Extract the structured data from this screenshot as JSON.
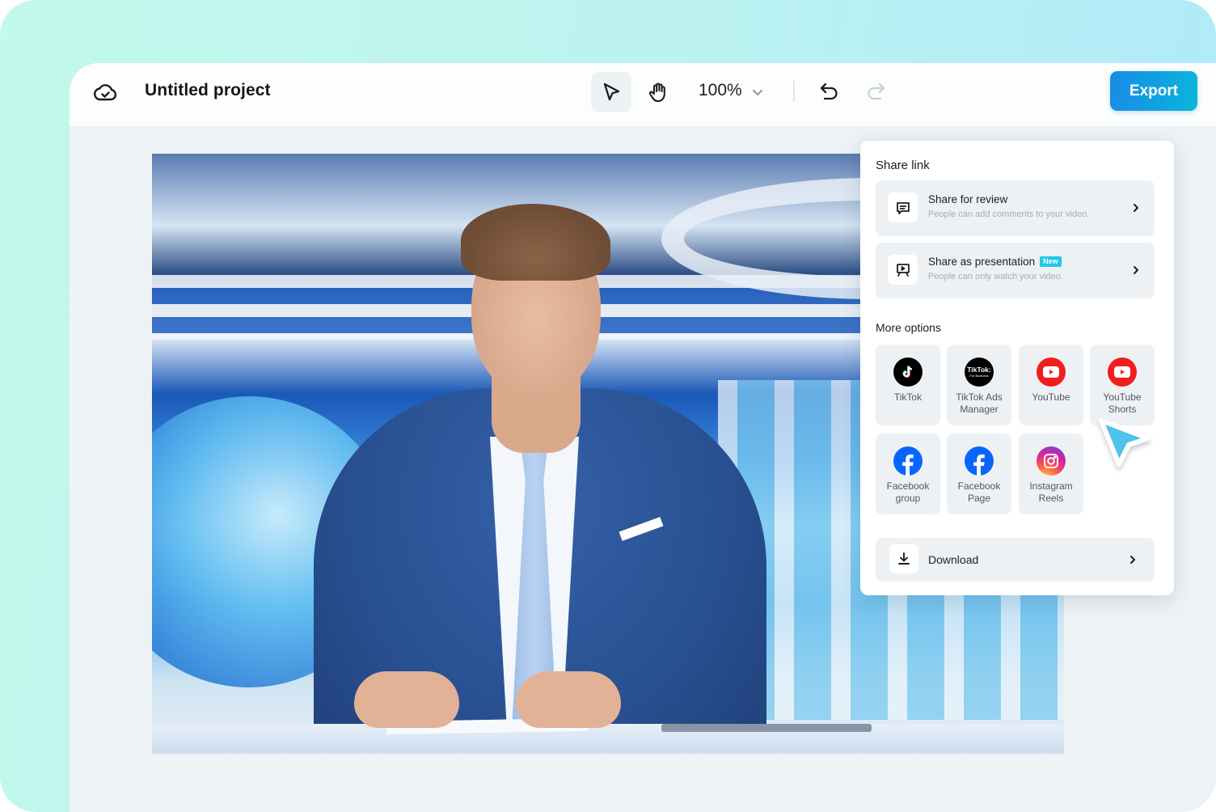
{
  "header": {
    "project_title": "Untitled project",
    "zoom_level": "100%",
    "export_label": "Export",
    "icons": {
      "cloud": "cloud-check-icon",
      "select": "pointer-arrow-icon",
      "hand": "hand-pan-icon",
      "zoom_dropdown": "chevron-down-icon",
      "undo": "undo-icon",
      "redo": "redo-icon"
    }
  },
  "canvas": {
    "media_description": "News anchor in blue suit at studio desk"
  },
  "share_panel": {
    "share_link_heading": "Share link",
    "share_options": [
      {
        "title": "Share for review",
        "subtitle": "People can add comments to your video.",
        "icon": "comment-icon",
        "badge": ""
      },
      {
        "title": "Share as presentation",
        "subtitle": "People can only watch your video.",
        "icon": "presentation-icon",
        "badge": "New"
      }
    ],
    "more_options_heading": "More options",
    "platforms": [
      {
        "label": "TikTok",
        "icon": "tiktok-icon",
        "color": "#000000"
      },
      {
        "label": "TikTok Ads Manager",
        "icon": "tiktok-for-business-icon",
        "color": "#000000",
        "icon_text": "TikTok:",
        "icon_subtext": "For Business"
      },
      {
        "label": "YouTube",
        "icon": "youtube-icon",
        "color": "#ff0000"
      },
      {
        "label": "YouTube Shorts",
        "icon": "youtube-shorts-icon",
        "color": "#ff0000"
      },
      {
        "label": "Facebook group",
        "icon": "facebook-icon",
        "color": "#0866ff"
      },
      {
        "label": "Facebook Page",
        "icon": "facebook-icon",
        "color": "#0866ff"
      },
      {
        "label": "Instagram Reels",
        "icon": "instagram-icon",
        "color": "#e1306c"
      }
    ],
    "download_label": "Download"
  },
  "colors": {
    "accent": "#1a8be6",
    "badge_new": "#1fc8e8",
    "cursor": "#4cc3ea"
  }
}
